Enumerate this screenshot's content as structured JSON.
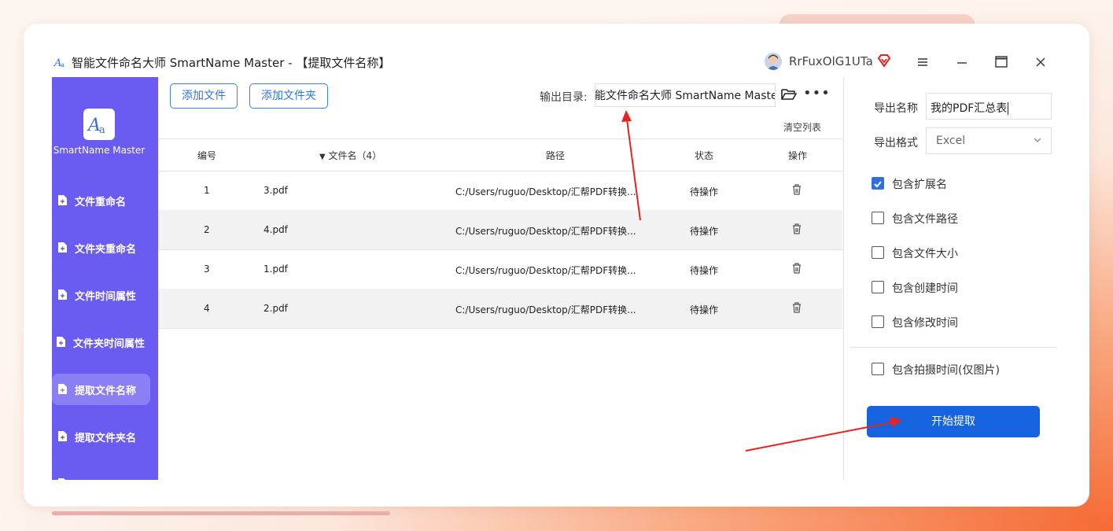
{
  "window": {
    "title": "智能文件命名大师 SmartName Master - 【提取文件名称】",
    "user": "RrFuxOlG1UTa",
    "controls": [
      "menu-icon",
      "minimize-icon",
      "maximize-icon",
      "close-icon"
    ]
  },
  "sidebar": {
    "app_name": "SmartName Master",
    "items": [
      {
        "label": "文件重命名",
        "active": false
      },
      {
        "label": "文件夹重命名",
        "active": false
      },
      {
        "label": "文件时间属性",
        "active": false
      },
      {
        "label": "文件夹时间属性",
        "active": false
      },
      {
        "label": "提取文件名称",
        "active": true
      },
      {
        "label": "提取文件夹名",
        "active": false
      }
    ]
  },
  "toolbar": {
    "add_file": "添加文件",
    "add_folder": "添加文件夹",
    "output_label": "输出目录:",
    "output_value": "能文件命名大师 SmartName Master",
    "clear_list": "清空列表"
  },
  "table": {
    "headers": {
      "index": "编号",
      "name": "文件名（4）",
      "path": "路径",
      "status": "状态",
      "action": "操作"
    },
    "rows": [
      {
        "index": "1",
        "name": "3.pdf",
        "path": "C:/Users/ruguo/Desktop/汇帮PDF转换...",
        "status": "待操作"
      },
      {
        "index": "2",
        "name": "4.pdf",
        "path": "C:/Users/ruguo/Desktop/汇帮PDF转换...",
        "status": "待操作"
      },
      {
        "index": "3",
        "name": "1.pdf",
        "path": "C:/Users/ruguo/Desktop/汇帮PDF转换...",
        "status": "待操作"
      },
      {
        "index": "4",
        "name": "2.pdf",
        "path": "C:/Users/ruguo/Desktop/汇帮PDF转换...",
        "status": "待操作"
      }
    ]
  },
  "panel": {
    "export_name_label": "导出名称",
    "export_name_value": "我的PDF汇总表",
    "export_format_label": "导出格式",
    "export_format_value": "Excel",
    "options": [
      {
        "label": "包含扩展名",
        "checked": true
      },
      {
        "label": "包含文件路径",
        "checked": false
      },
      {
        "label": "包含文件大小",
        "checked": false
      },
      {
        "label": "包含创建时间",
        "checked": false
      },
      {
        "label": "包含修改时间",
        "checked": false
      }
    ],
    "photo_option": {
      "label": "包含拍摄时间(仅图片)",
      "checked": false
    },
    "start_button": "开始提取"
  },
  "colors": {
    "sidebar": "#6a5cf0",
    "sidebar_active": "#8a7ff5",
    "primary_button": "#1663e0",
    "annotation_arrow": "#e8231e"
  }
}
